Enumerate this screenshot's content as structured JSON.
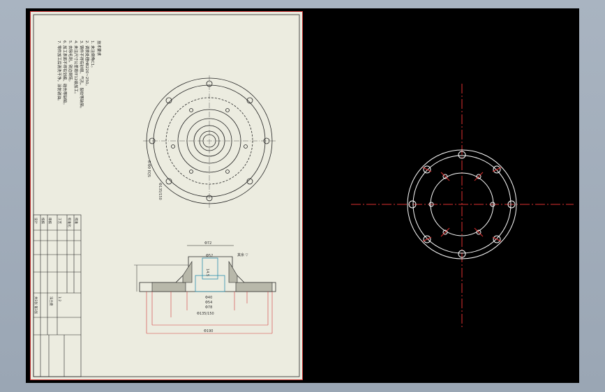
{
  "drawing": {
    "notes_title": "技术要求",
    "notes": [
      "1. 未注倒角C1。",
      "2. 调质处理HB220~250。",
      "3. 铸件不得有砂眼、气孔、裂纹等缺陷。",
      "4. 未注尺寸公差按IT12级加工。",
      "5. 去除毛刺，锐边倒钝。",
      "6. 加工表面不得有划痕、碰伤等缺陷。",
      "7. 零件加工后清洗干净，涂防锈油。"
    ],
    "dimensions": {
      "top_width": "Φ72",
      "inner_top": "Φ52",
      "bore_a": "Φ40",
      "bore_b": "Φ54",
      "bore_c": "Φ78",
      "flange": "Φ135/150",
      "overall": "Φ190",
      "height": "14.5",
      "tol_note": "其余 ▽",
      "hole_note": "8-Φ9 EQS"
    },
    "title_block": {
      "labels": [
        "设计",
        "校核",
        "审核",
        "工艺",
        "标准化",
        "批准"
      ],
      "part": "法兰盘",
      "scale": "1:2",
      "sheet": "共1张 第1张"
    }
  },
  "colors": {
    "viewport": "#000000",
    "sheet": "#ecece0",
    "border": "#d23a3a",
    "centerline": "#e03030",
    "geometry": "#ffffff"
  }
}
